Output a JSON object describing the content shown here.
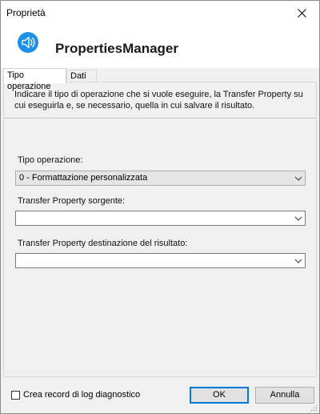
{
  "window": {
    "title": "Proprietà",
    "close_icon": "close-icon"
  },
  "header": {
    "icon": "speaker-icon",
    "accent_color": "#1e90e6",
    "app_name": "PropertiesManager"
  },
  "tabs": [
    {
      "label": "Tipo operazione",
      "active": true
    },
    {
      "label": "Dati",
      "active": false
    }
  ],
  "panel": {
    "instructions": "Indicare il tipo di operazione che si vuole eseguire, la Transfer Property su cui eseguirla e, se necessario, quella in cui salvare il risultato.",
    "operation_type": {
      "label": "Tipo operazione:",
      "value": "0 - Formattazione personalizzata"
    },
    "source_property": {
      "label": "Transfer Property sorgente:",
      "value": ""
    },
    "destination_property": {
      "label": "Transfer Property destinazione del risultato:",
      "value": ""
    }
  },
  "footer": {
    "log_checkbox_label": "Crea record di log diagnostico",
    "log_checkbox_checked": false,
    "ok_label": "OK",
    "cancel_label": "Annulla"
  }
}
